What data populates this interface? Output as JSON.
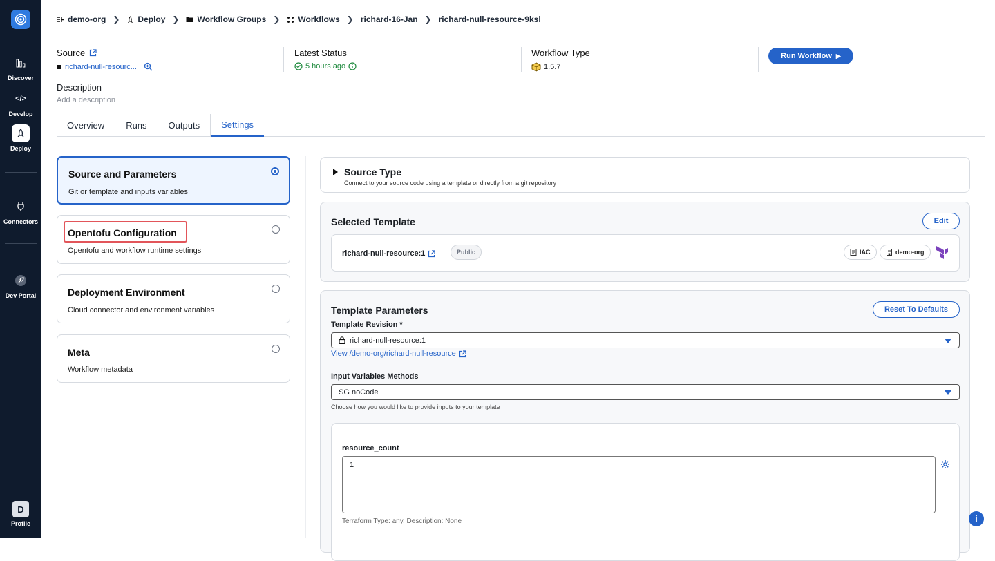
{
  "rail": {
    "items": [
      {
        "label": "Discover",
        "icon": "chart-icon"
      },
      {
        "label": "Develop",
        "icon": "code-icon"
      },
      {
        "label": "Deploy",
        "icon": "deploy-icon"
      },
      {
        "label": "Connectors",
        "icon": "plug-icon"
      },
      {
        "label": "Dev Portal",
        "icon": "rocket-icon"
      }
    ],
    "profile": {
      "initial": "D",
      "label": "Profile"
    }
  },
  "breadcrumb": [
    "demo-org",
    "Deploy",
    "Workflow Groups",
    "Workflows",
    "richard-16-Jan",
    "richard-null-resource-9ksl"
  ],
  "header": {
    "source_label": "Source",
    "source_value": "richard-null-resourc...",
    "latest_status_label": "Latest Status",
    "latest_status_value": "5 hours ago",
    "workflow_type_label": "Workflow Type",
    "workflow_type_value": "1.5.7",
    "run_button": "Run Workflow",
    "description_label": "Description",
    "description_placeholder": "Add a description"
  },
  "tabs": [
    "Overview",
    "Runs",
    "Outputs",
    "Settings"
  ],
  "active_tab": "Settings",
  "settings_cards": [
    {
      "title": "Source and Parameters",
      "subtitle": "Git or template and inputs variables",
      "selected": true
    },
    {
      "title": "Opentofu Configuration",
      "subtitle": "Opentofu and workflow runtime settings",
      "selected": false
    },
    {
      "title": "Deployment Environment",
      "subtitle": "Cloud connector and environment variables",
      "selected": false
    },
    {
      "title": "Meta",
      "subtitle": "Workflow metadata",
      "selected": false
    }
  ],
  "source_type": {
    "title": "Source Type",
    "subtitle": "Connect to your source code using a template or directly from a git repository"
  },
  "selected_template": {
    "title": "Selected Template",
    "edit_button": "Edit",
    "name": "richard-null-resource:1",
    "visibility": "Public",
    "tag_iac": "IAC",
    "tag_org": "demo-org"
  },
  "template_parameters": {
    "title": "Template Parameters",
    "reset_button": "Reset To Defaults",
    "revision_label": "Template Revision *",
    "revision_value": "richard-null-resource:1",
    "view_link": "View /demo-org/richard-null-resource",
    "methods_label": "Input Variables Methods",
    "methods_value": "SG noCode",
    "methods_hint": "Choose how you would like to provide inputs to your template",
    "var_name": "resource_count",
    "var_value": "1",
    "var_help": "Terraform Type: any. Description: None"
  },
  "colors": {
    "accent": "#2563c9",
    "rail": "#0f1b2d",
    "highlight": "#e2555a"
  }
}
